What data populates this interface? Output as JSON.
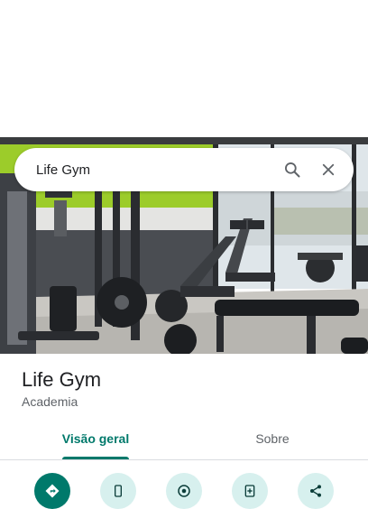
{
  "search": {
    "query": "Life Gym"
  },
  "place": {
    "name": "Life Gym",
    "category": "Academia"
  },
  "tabs": [
    {
      "label": "Visão geral",
      "selected": true
    },
    {
      "label": "Sobre",
      "selected": false
    }
  ],
  "actions": [
    {
      "icon": "directions-icon"
    },
    {
      "icon": "phone-icon"
    },
    {
      "icon": "location-icon"
    },
    {
      "icon": "save-icon"
    },
    {
      "icon": "share-icon"
    }
  ],
  "colors": {
    "accent": "#00796b",
    "action_bg": "#d7f0ee",
    "wall_green": "#9ccc2a"
  }
}
